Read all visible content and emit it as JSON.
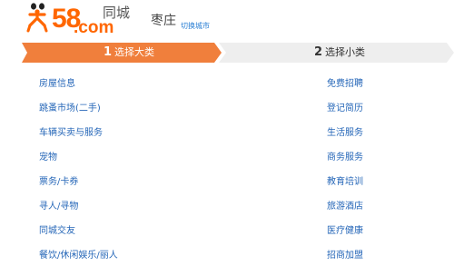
{
  "header": {
    "logo_number": "58",
    "logo_domain": ".com",
    "logo_brand": "同城",
    "city": "枣庄",
    "switch_city": "切换城市"
  },
  "steps": [
    {
      "number": "1",
      "label": "选择大类",
      "active": true
    },
    {
      "number": "2",
      "label": "选择小类",
      "active": false
    }
  ],
  "colors": {
    "brand_orange": "#ff6600",
    "active_step": "#f07f3c",
    "inactive_step": "#eeeeee",
    "link_blue": "#2667b8"
  },
  "categories_left": [
    "房屋信息",
    "跳蚤市场(二手)",
    "车辆买卖与服务",
    "宠物",
    "票务/卡券",
    "寻人/寻物",
    "同城交友",
    "餐饮/休闲娱乐/丽人"
  ],
  "categories_right": [
    "免费招聘",
    "登记简历",
    "生活服务",
    "商务服务",
    "教育培训",
    "旅游酒店",
    "医疗健康",
    "招商加盟"
  ]
}
